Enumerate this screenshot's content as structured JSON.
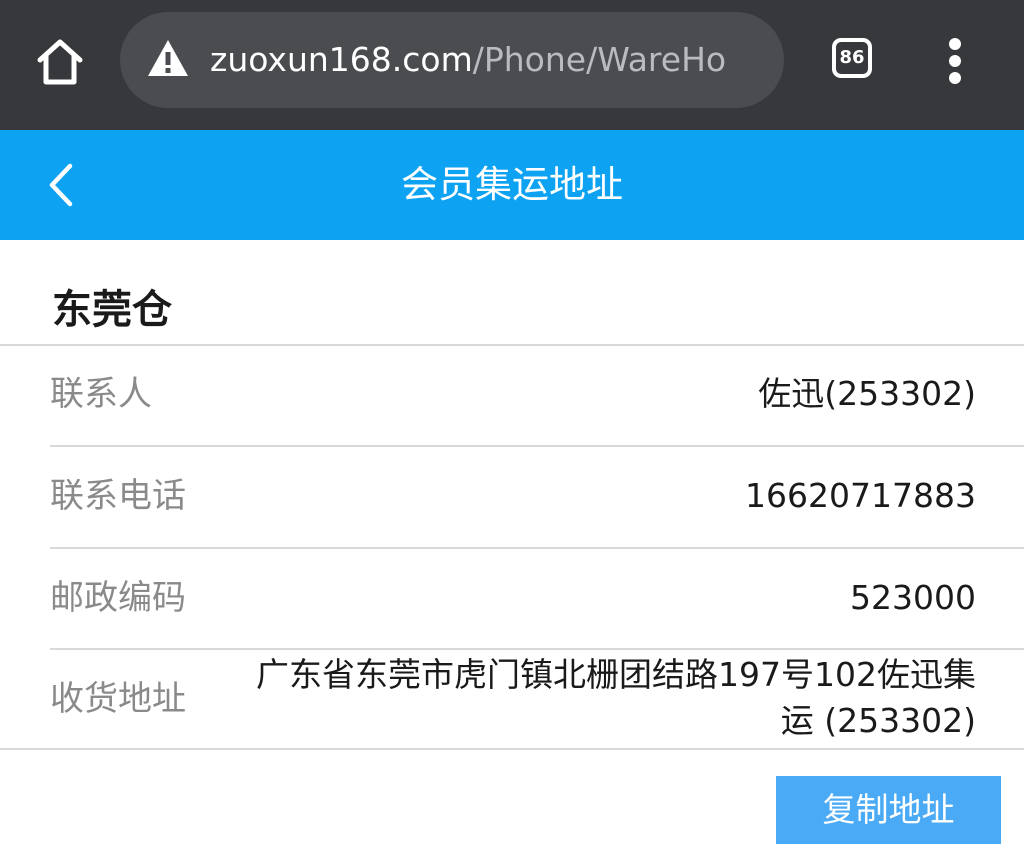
{
  "browser": {
    "url_domain": "zuoxun168.com",
    "url_path": "/Phone/WareHo",
    "tab_count": "86",
    "icons": {
      "home": "home-icon",
      "warning": "warning-icon",
      "tabs": "tabs-count-icon",
      "menu": "more-vert-icon"
    }
  },
  "header": {
    "title": "会员集运地址",
    "back_icon": "chevron-left-icon",
    "color": "#0da3f2"
  },
  "warehouse": {
    "name": "东莞仓",
    "rows": [
      {
        "label": "联系人",
        "value": "佐迅(253302)"
      },
      {
        "label": "联系电话",
        "value": "16620717883"
      },
      {
        "label": "邮政编码",
        "value": "523000"
      },
      {
        "label": "收货地址",
        "value_line1": "广东省东莞市虎门镇北栅团结路197号102佐迅集",
        "value_line2": "运 (253302)"
      }
    ]
  },
  "actions": {
    "copy_label": "复制地址",
    "copy_color": "#4aaaf5"
  }
}
